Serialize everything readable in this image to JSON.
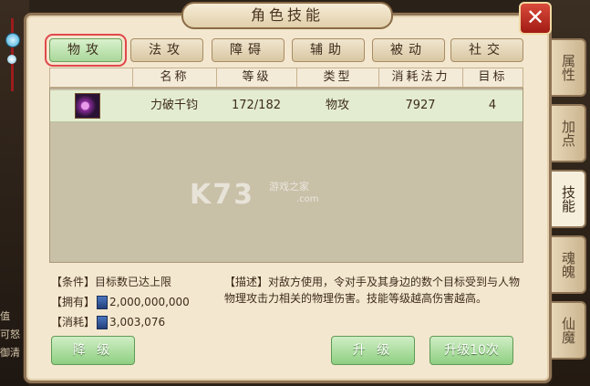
{
  "window": {
    "title": "角色技能",
    "close_label": "✕"
  },
  "filters": [
    {
      "label": "物攻",
      "active": true
    },
    {
      "label": "法攻",
      "active": false
    },
    {
      "label": "障碍",
      "active": false
    },
    {
      "label": "辅助",
      "active": false
    },
    {
      "label": "被动",
      "active": false
    },
    {
      "label": "社交",
      "active": false
    }
  ],
  "table": {
    "headers": [
      "名称",
      "等级",
      "类型",
      "消耗法力",
      "目标"
    ],
    "rows": [
      {
        "name": "力破千钧",
        "level": "172/182",
        "type": "物攻",
        "mana": "7927",
        "target": "4",
        "icon": "fist-skill-icon"
      }
    ]
  },
  "watermark": {
    "logo": "K73",
    "sub": "游戏之家",
    "url": ".com"
  },
  "info": {
    "condition": "【条件】目标数已达上限",
    "owned_label": "【拥有】",
    "owned_value": "2,000,000,000",
    "cost_label": "【消耗】",
    "cost_value": "3,003,076",
    "currency_icon": "book-icon"
  },
  "description": "【描述】对敌方使用，令对手及其身边的数个目标受到与人物物理攻击力相关的物理伤害。技能等级越高伤害越高。",
  "buttons": {
    "downgrade": "降 级",
    "upgrade": "升 级",
    "upgrade10": "升级10次"
  },
  "side_tabs": [
    {
      "label": "属性",
      "active": false
    },
    {
      "label": "加点",
      "active": false
    },
    {
      "label": "技能",
      "active": true
    },
    {
      "label": "魂魄",
      "active": false
    },
    {
      "label": "仙魔",
      "active": false
    }
  ],
  "left_edge_text": [
    "值",
    "可怒",
    "御清"
  ]
}
